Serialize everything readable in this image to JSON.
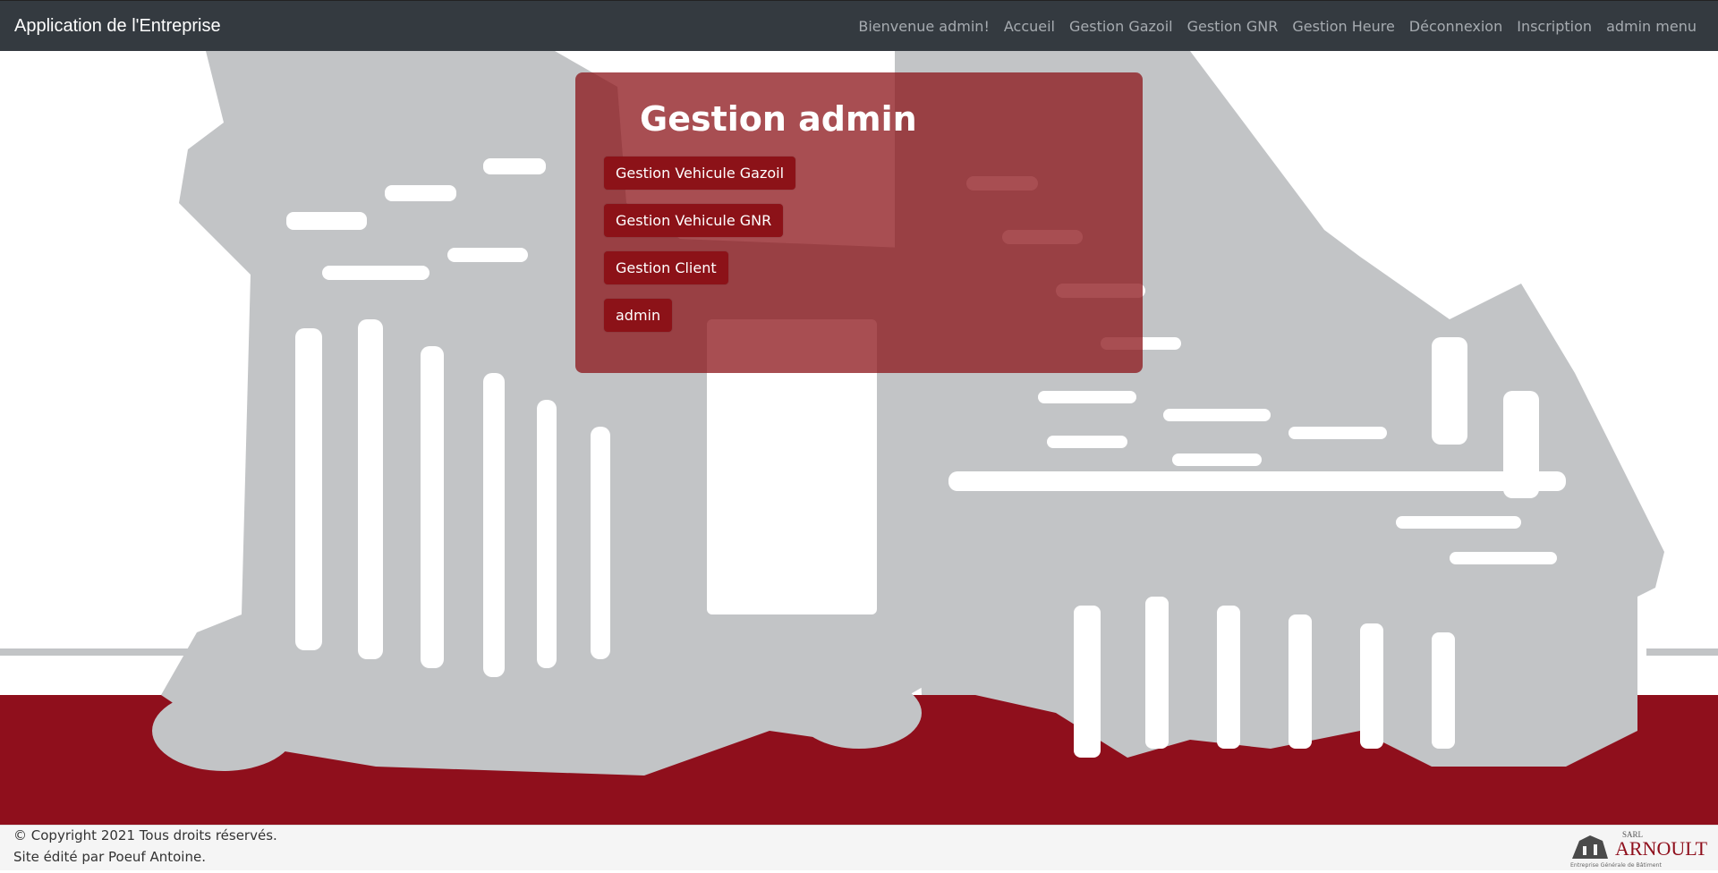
{
  "navbar": {
    "brand": "Application de l'Entreprise",
    "items": [
      {
        "label": "Bienvenue admin!"
      },
      {
        "label": "Accueil"
      },
      {
        "label": "Gestion Gazoil"
      },
      {
        "label": "Gestion GNR"
      },
      {
        "label": "Gestion Heure"
      },
      {
        "label": "Déconnexion"
      },
      {
        "label": "Inscription"
      },
      {
        "label": "admin menu"
      }
    ]
  },
  "card": {
    "title": "Gestion admin",
    "buttons": [
      {
        "label": "Gestion Vehicule Gazoil"
      },
      {
        "label": "Gestion Vehicule GNR"
      },
      {
        "label": "Gestion Client"
      },
      {
        "label": "admin"
      }
    ]
  },
  "footer": {
    "copyright": "© Copyright 2021 Tous droits réservés.",
    "edited_by": "Site édité par Poeuf Antoine."
  },
  "logo": {
    "line1": "SARL",
    "line2": "ARNOULT",
    "line3": "Entreprise Générale de Bâtiment"
  },
  "colors": {
    "navbar_bg": "#343a40",
    "accent_red": "#8c1218",
    "bg_band_red": "#8f0f1c",
    "sketch_gray": "#c2c4c6"
  }
}
